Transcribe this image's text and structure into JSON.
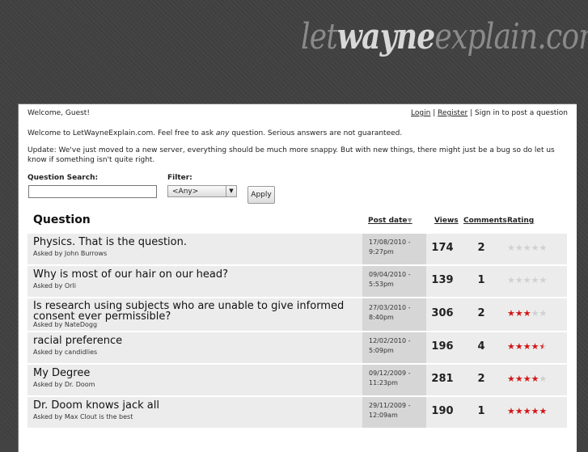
{
  "site": {
    "logo_pre": "let",
    "logo_mid": "wayne",
    "logo_post": "explain",
    "logo_dot": ".",
    "logo_tld": "com"
  },
  "header": {
    "welcome": "Welcome, Guest!",
    "login_label": "Login",
    "separator": "|",
    "register_label": "Register",
    "signin_text": "Sign in to post a question"
  },
  "intro_prefix": "Welcome to LetWayneExplain.com. Feel free to ask ",
  "intro_emphasis": "any",
  "intro_suffix": " question. Serious answers are not guaranteed.",
  "update_text": "Update: We've just moved to a new server, everything should be much more snappy. But with new things, there might just be a bug so do let us know if something isn't quite right.",
  "search": {
    "label": "Question Search:",
    "value": "",
    "placeholder": ""
  },
  "filter": {
    "label": "Filter:",
    "selected": "<Any>"
  },
  "apply_label": "Apply",
  "table": {
    "col_question": "Question",
    "col_post_date": "Post date",
    "col_views": "Views",
    "col_comments": "Comments",
    "col_rating": "Rating",
    "rows": [
      {
        "title": "Physics. That is the question.",
        "asked": "Asked by John Burrows",
        "date1": "17/08/2010 -",
        "date2": "9:27pm",
        "views": "174",
        "comments": "2",
        "rating": 0
      },
      {
        "title": "Why is most of our hair on our head?",
        "asked": "Asked by Orli",
        "date1": "09/04/2010 -",
        "date2": "5:53pm",
        "views": "139",
        "comments": "1",
        "rating": 0
      },
      {
        "title": "Is research using subjects who are unable to give informed consent ever permissible?",
        "asked": "Asked by NateDogg",
        "date1": "27/03/2010 -",
        "date2": "8:40pm",
        "views": "306",
        "comments": "2",
        "rating": 3
      },
      {
        "title": "racial preference",
        "asked": "Asked by candidlies",
        "date1": "12/02/2010 -",
        "date2": "5:09pm",
        "views": "196",
        "comments": "4",
        "rating": 4.5
      },
      {
        "title": "My Degree",
        "asked": "Asked by Dr. Doom",
        "date1": "09/12/2009 -",
        "date2": "11:23pm",
        "views": "281",
        "comments": "2",
        "rating": 4
      },
      {
        "title": "Dr. Doom knows jack all",
        "asked": "Asked by Max Clout is the best",
        "date1": "29/11/2009 -",
        "date2": "12:09am",
        "views": "190",
        "comments": "1",
        "rating": 5
      }
    ]
  },
  "colors": {
    "star_on": "#d21717",
    "star_off": "#d0d0d0",
    "row_bg": "#ececec",
    "date_bg": "#d6d6d6"
  }
}
